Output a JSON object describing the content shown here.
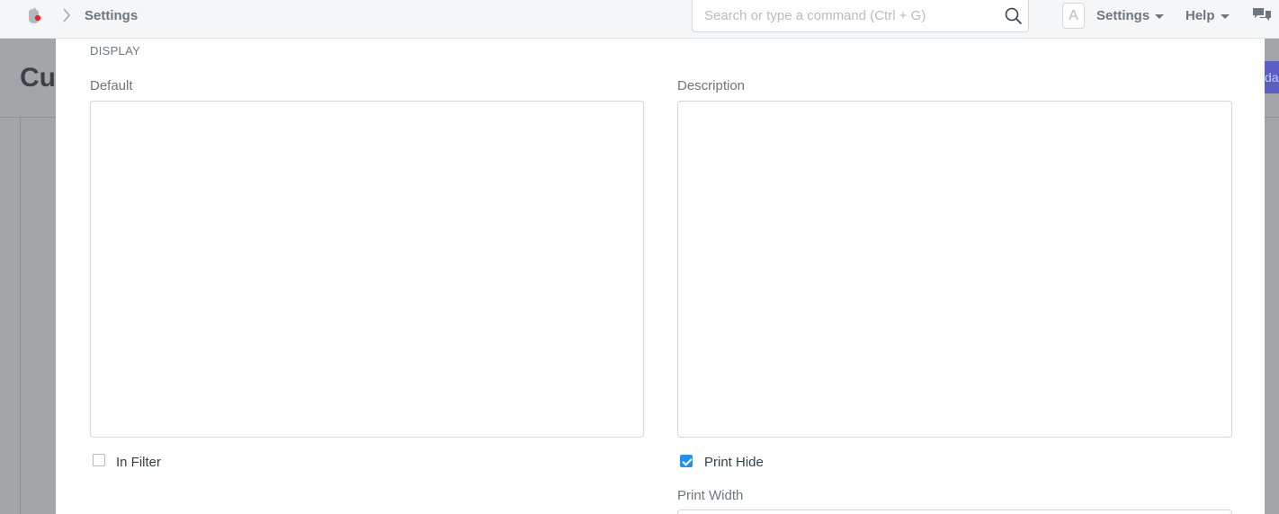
{
  "navbar": {
    "breadcrumb": "Settings",
    "search_placeholder": "Search or type a command (Ctrl + G)",
    "avatar_letter": "A",
    "settings_label": "Settings",
    "help_label": "Help",
    "icons": [
      "app-logo-icon",
      "chevron-right-icon",
      "search-icon",
      "chat-icon",
      "caret-down-icon"
    ]
  },
  "background_page": {
    "title_fragment": "Cus",
    "button_fragment": "da"
  },
  "modal": {
    "section_heading": "DISPLAY",
    "default_label": "Default",
    "default_value": "",
    "description_label": "Description",
    "description_value": "",
    "in_filter_label": "In Filter",
    "in_filter_checked": false,
    "print_hide_label": "Print Hide",
    "print_hide_checked": true,
    "print_width_label": "Print Width"
  },
  "colors": {
    "navbar_bg": "#f5f6f8",
    "overlay": "#a3a6a8",
    "checkbox_active": "#2490ef",
    "label_text": "#6c7680"
  }
}
